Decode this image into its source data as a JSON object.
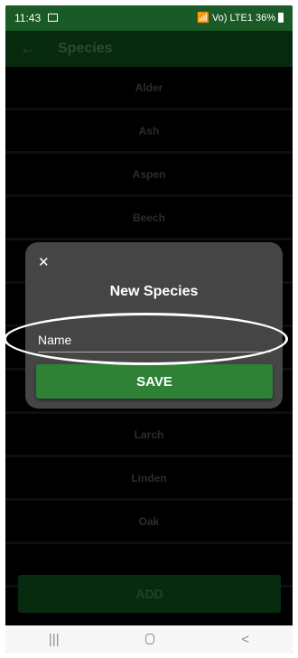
{
  "status_bar": {
    "time": "11:43",
    "network": "Vo) LTE1",
    "battery": "36%"
  },
  "app_bar": {
    "back_icon": "arrow-left-icon",
    "title": "Species"
  },
  "species_list": [
    {
      "label": "Alder"
    },
    {
      "label": "Ash"
    },
    {
      "label": "Aspen"
    },
    {
      "label": "Beech"
    },
    {
      "label": ""
    },
    {
      "label": ""
    },
    {
      "label": ""
    },
    {
      "label": ""
    },
    {
      "label": "Larch"
    },
    {
      "label": "Linden"
    },
    {
      "label": "Oak"
    },
    {
      "label": ""
    }
  ],
  "add_button": {
    "label": "ADD"
  },
  "dialog": {
    "close_icon": "close-icon",
    "title": "New Species",
    "name_field": {
      "placeholder": "Name",
      "value": ""
    },
    "save_label": "SAVE"
  },
  "nav_bar": {
    "recents": "|||",
    "home": "home-icon",
    "back": "<"
  },
  "colors": {
    "status_bar": "#1a5a26",
    "app_bar": "#072a0f",
    "dialog": "#454545",
    "save_button": "#2f8135",
    "add_button": "#082b0f"
  }
}
